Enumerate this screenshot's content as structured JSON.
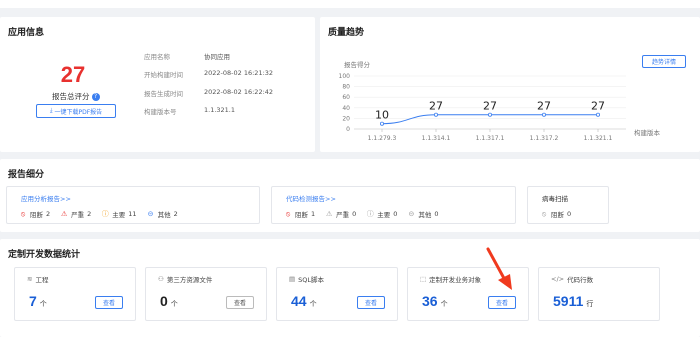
{
  "app_info": {
    "title": "应用信息",
    "score": "27",
    "score_label": "报告总评分",
    "pdf_button": "一键下载PDF报告",
    "fields": [
      {
        "label": "应用名称",
        "value": "协同应用"
      },
      {
        "label": "开始构建时间",
        "value": "2022-08-02 16:21:32"
      },
      {
        "label": "报告生成时间",
        "value": "2022-08-02 16:22:42"
      },
      {
        "label": "构建版本号",
        "value": "1.1.321.1"
      }
    ]
  },
  "quality_trend": {
    "title": "质量趋势",
    "button": "趋势详情"
  },
  "chart_data": {
    "type": "line",
    "ylabel": "报告得分",
    "xlabel": "构建版本",
    "x": [
      "1.1.279.3",
      "1.1.314.1",
      "1.1.317.1",
      "1.1.317.2",
      "1.1.321.1"
    ],
    "values": [
      10,
      27,
      27,
      27,
      27
    ],
    "yticks": [
      0,
      20,
      40,
      60,
      80,
      100
    ],
    "ylim": [
      0,
      100
    ],
    "grid": true,
    "colors": {
      "line": "#3a7ef0"
    }
  },
  "report_detail": {
    "title": "报告细分",
    "app_analysis": {
      "title": "应用分析报告>>",
      "stats": [
        {
          "icon": "block-icon",
          "label": "阻断",
          "value": "2"
        },
        {
          "icon": "warning-icon",
          "label": "严重",
          "value": "2"
        },
        {
          "icon": "alert-icon",
          "label": "主要",
          "value": "11"
        },
        {
          "icon": "more-icon",
          "label": "其他",
          "value": "2"
        }
      ]
    },
    "code_check": {
      "title": "代码检测报告>>",
      "stats": [
        {
          "icon": "block-icon",
          "label": "阻断",
          "value": "1"
        },
        {
          "icon": "warning-icon",
          "label": "严重",
          "value": "0"
        },
        {
          "icon": "alert-icon",
          "label": "主要",
          "value": "0"
        },
        {
          "icon": "more-icon",
          "label": "其他",
          "value": "0"
        }
      ]
    },
    "virus_scan": {
      "title": "病毒扫描",
      "stats": [
        {
          "icon": "block-icon",
          "label": "阻断",
          "value": "0"
        }
      ]
    }
  },
  "custom_stats": {
    "title": "定制开发数据统计",
    "cards": [
      {
        "label": "工程",
        "value": "7",
        "unit": "个",
        "button": "查看"
      },
      {
        "label": "第三方资源文件",
        "value": "0",
        "unit": "个",
        "button": "查看"
      },
      {
        "label": "SQL脚本",
        "value": "44",
        "unit": "个",
        "button": "查看"
      },
      {
        "label": "定制开发业务对象",
        "value": "36",
        "unit": "个",
        "button": "查看"
      },
      {
        "label": "代码行数",
        "value": "5911",
        "unit": "行"
      }
    ]
  }
}
